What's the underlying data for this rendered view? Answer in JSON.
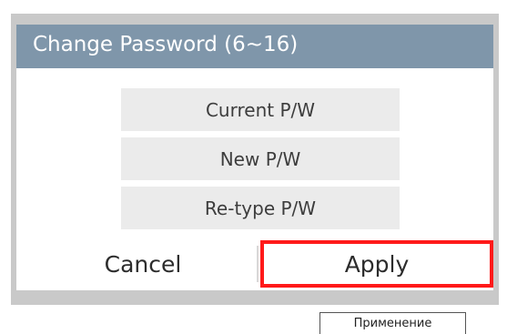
{
  "dialog": {
    "title": "Change Password (6~16)",
    "fields": [
      {
        "label": "Current P/W"
      },
      {
        "label": "New P/W"
      },
      {
        "label": "Re-type P/W"
      }
    ],
    "buttons": {
      "cancel": "Cancel",
      "apply": "Apply"
    }
  },
  "annotation": {
    "caption": "Применение"
  },
  "colors": {
    "title_bar": "#7f96aa",
    "field_background": "#ebebeb",
    "highlight_border": "#ff1a1a",
    "frame": "#c9c9c9"
  }
}
